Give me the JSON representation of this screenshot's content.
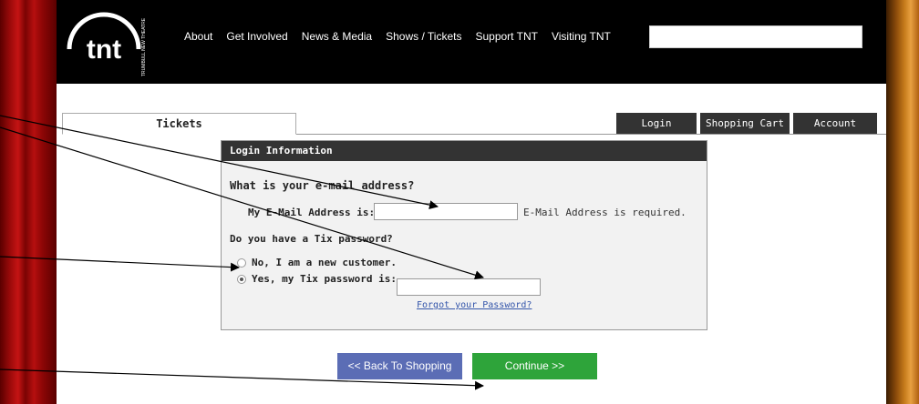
{
  "header": {
    "logo_alt": "TNT Trumbull New Theatre",
    "logo_text": "tnt",
    "logo_side_text": "TRUMBULL NEW THEATRE",
    "nav": [
      "About",
      "Get Involved",
      "News & Media",
      "Shows / Tickets",
      "Support TNT",
      "Visiting TNT"
    ],
    "search_value": ""
  },
  "tabs": {
    "active_label": "Tickets",
    "right": [
      "Login",
      "Shopping Cart",
      "Account"
    ]
  },
  "login": {
    "title": "Login Information",
    "email_question": "What is your e-mail address?",
    "email_label": "My E-Mail Address is:",
    "email_value": "",
    "email_required": "E-Mail Address is required.",
    "password_question": "Do you have a Tix password?",
    "option_new": "No, I am a new customer.",
    "option_existing": "Yes, my Tix password is:",
    "selected_option": "existing",
    "password_value": "",
    "forgot_link": "Forgot your Password?"
  },
  "actions": {
    "back": "<< Back To Shopping",
    "continue": "Continue >>"
  },
  "colors": {
    "header_bg": "#000000",
    "panel_header": "#333333",
    "back_button": "#5b6db5",
    "continue_button": "#2ea43a",
    "curtain_red": "#c41414",
    "link": "#3355aa"
  }
}
